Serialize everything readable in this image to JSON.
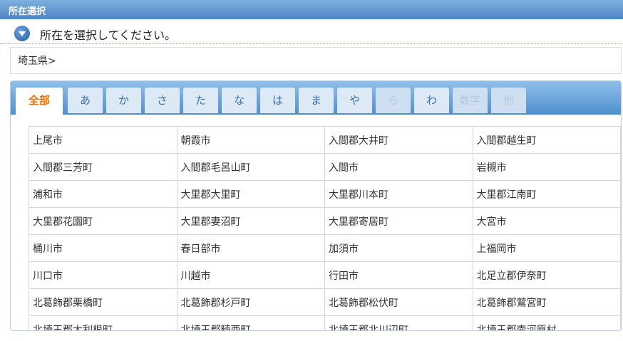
{
  "window": {
    "title": "所在選択"
  },
  "header": {
    "instruction": "所在を選択してください。"
  },
  "breadcrumb": {
    "text": "埼玉県>"
  },
  "tabs": [
    {
      "label": "全部",
      "state": "active"
    },
    {
      "label": "あ",
      "state": "normal"
    },
    {
      "label": "か",
      "state": "normal"
    },
    {
      "label": "さ",
      "state": "normal"
    },
    {
      "label": "た",
      "state": "normal"
    },
    {
      "label": "な",
      "state": "normal"
    },
    {
      "label": "は",
      "state": "normal"
    },
    {
      "label": "ま",
      "state": "normal"
    },
    {
      "label": "や",
      "state": "normal"
    },
    {
      "label": "ら",
      "state": "disabled"
    },
    {
      "label": "わ",
      "state": "normal"
    },
    {
      "label": "数字",
      "state": "disabled"
    },
    {
      "label": "他",
      "state": "disabled"
    }
  ],
  "places": [
    [
      "上尾市",
      "朝霞市",
      "入間郡大井町",
      "入間郡越生町"
    ],
    [
      "入間郡三芳町",
      "入間郡毛呂山町",
      "入間市",
      "岩槻市"
    ],
    [
      "浦和市",
      "大里郡大里町",
      "大里郡川本町",
      "大里郡江南町"
    ],
    [
      "大里郡花園町",
      "大里郡妻沼町",
      "大里郡寄居町",
      "大宮市"
    ],
    [
      "桶川市",
      "春日部市",
      "加須市",
      "上福岡市"
    ],
    [
      "川口市",
      "川越市",
      "行田市",
      "北足立郡伊奈町"
    ],
    [
      "北葛飾郡栗橋町",
      "北葛飾郡杉戸町",
      "北葛飾郡松伏町",
      "北葛飾郡鷲宮町"
    ],
    [
      "北埼玉郡大利根町",
      "北埼玉郡騎西町",
      "北埼玉郡北川辺町",
      "北埼玉郡南河原村"
    ]
  ],
  "colors": {
    "accent": "#f07000",
    "tabbar": "#4f8fce",
    "titlebar": "#4f86c6"
  }
}
